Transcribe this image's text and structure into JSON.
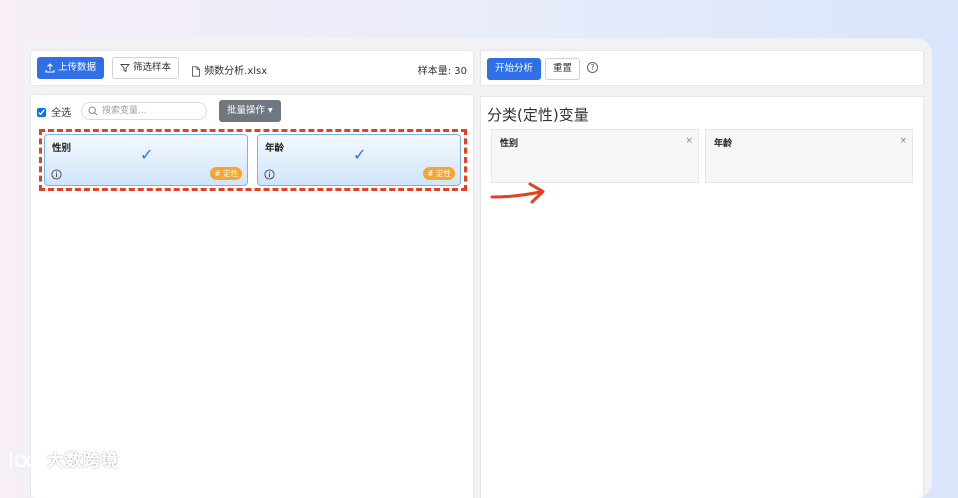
{
  "left_toolbar": {
    "upload_label": "上传数据",
    "filter_label": "筛选样本",
    "file_name": "频数分析.xlsx",
    "sample_size_label": "样本量:",
    "sample_size_value": "30"
  },
  "right_toolbar": {
    "start_label": "开始分析",
    "reset_label": "重置",
    "help_symbol": "?"
  },
  "variable_list": {
    "select_all_label": "全选",
    "select_all_checked": true,
    "search_placeholder": "搜索变量...",
    "batch_label": "批量操作",
    "items": [
      {
        "name": "性别",
        "check": "✓",
        "tag": "# 定性"
      },
      {
        "name": "年龄",
        "check": "✓",
        "tag": "# 定性"
      }
    ]
  },
  "analysis_panel": {
    "title": "分类(定性)变量",
    "items": [
      {
        "name": "性别",
        "close": "×"
      },
      {
        "name": "年龄",
        "close": "×"
      }
    ]
  },
  "watermark": {
    "text": "大数跨境"
  },
  "colors": {
    "primary": "#2f6fe8",
    "annotation_red": "#e8401c",
    "tag_orange": "#f4a632",
    "batch_gray": "#6f7780"
  }
}
